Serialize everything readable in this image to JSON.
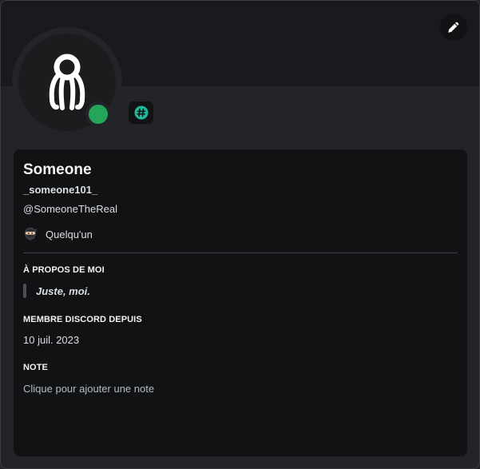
{
  "profile": {
    "display_name": "Someone",
    "username": "_someone101_",
    "pronouns": "@SomeoneTheReal",
    "custom_status": "Quelqu'un",
    "status": "online",
    "status_color": "#23a55a"
  },
  "about": {
    "title": "À PROPOS DE MOI",
    "text": "Juste, moi."
  },
  "member_since": {
    "title": "MEMBRE DISCORD DEPUIS",
    "date": "10 juil. 2023"
  },
  "note": {
    "title": "NOTE",
    "placeholder": "Clique pour ajouter une note"
  },
  "icons": {
    "edit": "pencil-icon",
    "badge": "hashtag-badge-icon",
    "status_emoji": "ninja-emoji-icon"
  },
  "colors": {
    "background": "#232428",
    "banner": "#1a1a1e",
    "inner_panel": "#111214",
    "badge_accent": "#1abc9c"
  }
}
